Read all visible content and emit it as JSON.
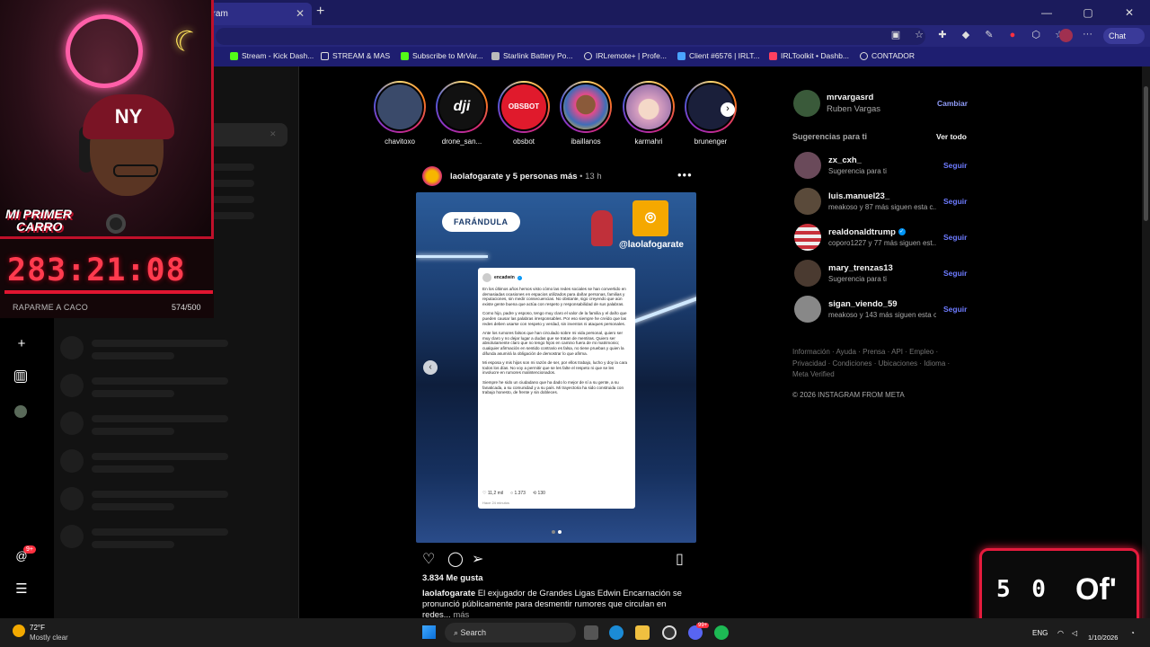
{
  "browser": {
    "active_tab_title": "gram",
    "new_tab_icon": "plus-icon",
    "window_controls": [
      "—",
      "▢",
      "✕"
    ],
    "copilot_label": "Chat",
    "bookmarks": [
      {
        "label": "Stream - Kick Dash...",
        "color": "#53fc18"
      },
      {
        "label": "STREAM & MAS",
        "color": "#dddddd"
      },
      {
        "label": "Subscribe to MrVar...",
        "color": "#53fc18"
      },
      {
        "label": "Starlink Battery Po...",
        "color": "#bbbbbb"
      },
      {
        "label": "IRLremote+ | Profe...",
        "color": "#dddddd"
      },
      {
        "label": "Client #6576 | IRLT...",
        "color": "#4aa3ff"
      },
      {
        "label": "IRLToolkit • Dashb...",
        "color": "#ff4060"
      },
      {
        "label": "CONTADOR",
        "color": "#dddddd"
      }
    ]
  },
  "stream_overlay": {
    "carro_text_1": "MI PRIMER",
    "carro_text_2": "CARRO",
    "cap_logo": "NY",
    "timer": "283:21:08",
    "goal_label": "RAPARME A CACO",
    "goal_progress": "574/500",
    "counter_digits": "5 0",
    "counter_text": "Of'"
  },
  "instagram": {
    "nav_badge": "9+",
    "stories": [
      {
        "name": "chavitoxo",
        "color": "#3a4a6a"
      },
      {
        "name": "drone_san...",
        "color": "#111111"
      },
      {
        "name": "obsbot",
        "color": "#e01a2c",
        "text": "OBSBOT"
      },
      {
        "name": "ibaillanos",
        "color": "#3f6db8"
      },
      {
        "name": "karmahri",
        "color": "#e0b8d0"
      },
      {
        "name": "brunenger",
        "color": "#1a1f3a"
      }
    ],
    "post": {
      "author": "laolafogarate y 5 personas más",
      "time": " • 13 h",
      "more": "•••",
      "image": {
        "tag": "FARÁNDULA",
        "logo_handle": "@laolafogarate",
        "tweet_user": "encadwin",
        "tweet_paragraphs": [
          "En los últimos años hemos visto cómo las redes sociales se han convertido en demasiadas ocasiones en espacios utilizados para dañar personas, familias y reputaciones, sin medir consecuencias. No obstante, sigo creyendo que aún existe gente buena que actúa con respeto y responsabilidad de sus palabras.",
          "Como hijo, padre y esposo, tengo muy claro el valor de la familia y el daño que pueden causar las palabras irresponsables. Por eso siempre he creído que las redes deben usarse con respeto y verdad, sin inventos ni ataques personales.",
          "Ante los rumores falsos que han circulado sobre mi vida personal, quiero ser muy claro y no dejar lugar a dudas que se tratan de mentiras. Quiero ser absolutamente claro que no tengo hijos en camino fuera de mi matrimonio; cualquier afirmación en sentido contrario es falsa, no tiene pruebas y quien la difunda asumirá la obligación de demostrar lo que afirma.",
          "Mi esposa y mis hijos son mi razón de ser, por ellos trabajo, lucho y doy la cara todos los días. No voy a permitir que se les falte el respeto ni que se les involucre en rumores malintencionados.",
          "Siempre he sido un ciudadano que ha dado lo mejor de sí a su gente, a su fanaticada, a su comunidad y a su país. Mi trayectoria ha sido construida con trabajo honesto, de frente y sin dobleces."
        ],
        "tweet_likes": "11,2 mil",
        "tweet_replies": "1.373",
        "tweet_reposts": "130",
        "tweet_time": "Hace 24 minutos"
      },
      "likes": "3.834 Me gusta",
      "caption_user": "laolafogarate",
      "caption_text": " El exjugador de Grandes Ligas Edwin Encarnación se pronunció públicamente para desmentir rumores que circulan en redes...",
      "caption_more": " más"
    },
    "me": {
      "username": "mrvargasrd",
      "name": "Ruben Vargas",
      "switch_label": "Cambiar"
    },
    "suggestions_title": "Sugerencias para ti",
    "suggestions_see_all": "Ver todo",
    "suggestions": [
      {
        "user": "zx_cxh_",
        "desc": "Sugerencia para ti",
        "follow": "Seguir",
        "color": "#6a4a5a",
        "verified": false
      },
      {
        "user": "luis.manuel23_",
        "desc": "meakoso y 87 más siguen esta c...",
        "follow": "Seguir",
        "color": "#5a4a3a",
        "verified": false
      },
      {
        "user": "realdonaldtrump",
        "desc": "coporo1227 y 77 más siguen est...",
        "follow": "Seguir",
        "color": "#c8303a",
        "verified": true
      },
      {
        "user": "mary_trenzas13",
        "desc": "Sugerencia para ti",
        "follow": "Seguir",
        "color": "#4a3a30",
        "verified": false
      },
      {
        "user": "sigan_viendo_59",
        "desc": "meakoso y 143 más siguen esta c...",
        "follow": "Seguir",
        "color": "#888888",
        "verified": false
      }
    ],
    "footer_links": "Información · Ayuda · Prensa · API · Empleo · Privacidad · Condiciones · Ubicaciones · Idioma · Meta Verified",
    "copyright": "© 2026 INSTAGRAM FROM META"
  },
  "taskbar": {
    "weather_temp": "72°F",
    "weather_desc": "Mostly clear",
    "search_label": "Search",
    "language": "ENG",
    "date": "1/10/2026",
    "discord_badge": "99+"
  }
}
